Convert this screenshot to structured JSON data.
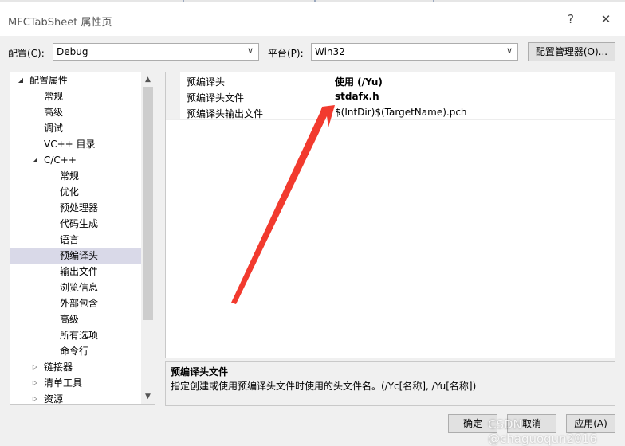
{
  "window": {
    "title": "MFCTabSheet 属性页",
    "help_glyph": "?",
    "close_glyph": "✕"
  },
  "config": {
    "config_label": "配置(C):",
    "config_value": "Debug",
    "platform_label": "平台(P):",
    "platform_value": "Win32",
    "manager_button": "配置管理器(O)..."
  },
  "tree": {
    "items": [
      {
        "label": "配置属性",
        "level": 0,
        "expand": "open"
      },
      {
        "label": "常规",
        "level": 1
      },
      {
        "label": "高级",
        "level": 1
      },
      {
        "label": "调试",
        "level": 1
      },
      {
        "label": "VC++ 目录",
        "level": 1
      },
      {
        "label": "C/C++",
        "level": 1,
        "expand": "open"
      },
      {
        "label": "常规",
        "level": 2
      },
      {
        "label": "优化",
        "level": 2
      },
      {
        "label": "预处理器",
        "level": 2
      },
      {
        "label": "代码生成",
        "level": 2
      },
      {
        "label": "语言",
        "level": 2
      },
      {
        "label": "预编译头",
        "level": 2,
        "selected": true
      },
      {
        "label": "输出文件",
        "level": 2
      },
      {
        "label": "浏览信息",
        "level": 2
      },
      {
        "label": "外部包含",
        "level": 2
      },
      {
        "label": "高级",
        "level": 2
      },
      {
        "label": "所有选项",
        "level": 2
      },
      {
        "label": "命令行",
        "level": 2
      },
      {
        "label": "链接器",
        "level": 1,
        "expand": "closed"
      },
      {
        "label": "清单工具",
        "level": 1,
        "expand": "closed"
      },
      {
        "label": "资源",
        "level": 1,
        "expand": "closed"
      }
    ]
  },
  "grid": {
    "rows": [
      {
        "name": "预编译头",
        "value": "使用 (/Yu)",
        "bold": true
      },
      {
        "name": "预编译头文件",
        "value": "stdafx.h",
        "bold": true
      },
      {
        "name": "预编译头输出文件",
        "value": "$(IntDir)$(TargetName).pch",
        "bold": false
      }
    ]
  },
  "description": {
    "title": "预编译头文件",
    "text": "指定创建或使用预编译头文件时使用的头文件名。(/Yc[名称], /Yu[名称])"
  },
  "footer": {
    "ok": "确定",
    "cancel": "取消",
    "apply": "应用(A)"
  },
  "watermark": "CSDN @chaguoqun2016",
  "colors": {
    "annotation_arrow": "#f23a2e",
    "selected_tree_bg": "#d9d9e8"
  }
}
